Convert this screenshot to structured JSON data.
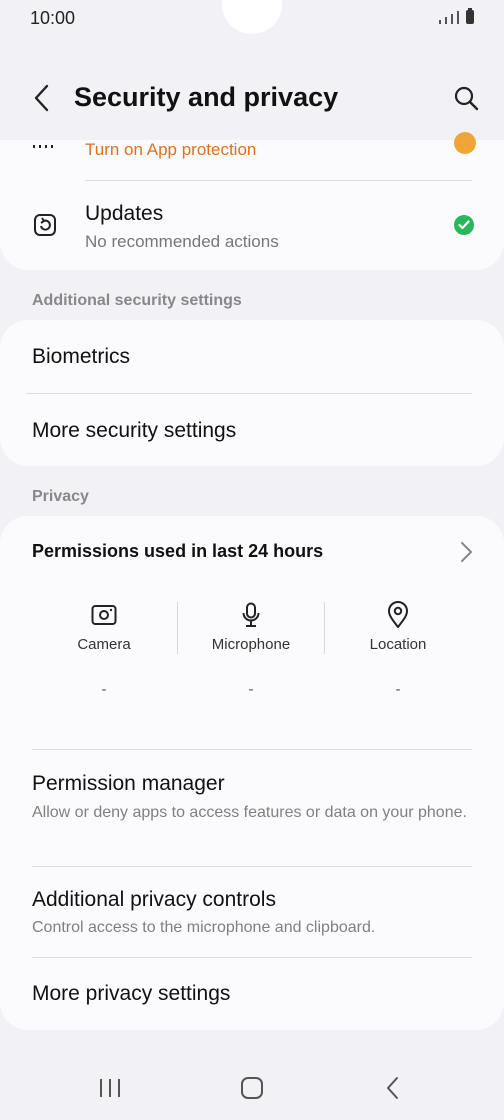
{
  "status_bar": {
    "time": "10:00"
  },
  "header": {
    "title": "Security and privacy"
  },
  "top_card": {
    "warning_text": "Turn on App protection",
    "updates_title": "Updates",
    "updates_subtitle": "No recommended actions"
  },
  "sections": {
    "additional_security": "Additional security settings",
    "privacy": "Privacy"
  },
  "security_items": [
    {
      "label": "Biometrics"
    },
    {
      "label": "More security settings"
    }
  ],
  "permissions": {
    "title": "Permissions used in last 24 hours",
    "items": [
      {
        "label": "Camera",
        "value": "-",
        "icon": "camera-icon"
      },
      {
        "label": "Microphone",
        "value": "-",
        "icon": "microphone-icon"
      },
      {
        "label": "Location",
        "value": "-",
        "icon": "location-icon"
      }
    ]
  },
  "privacy_items": [
    {
      "title": "Permission manager",
      "subtitle": "Allow or deny apps to access features or data on your phone."
    },
    {
      "title": "Additional privacy controls",
      "subtitle": "Control access to the microphone and clipboard."
    },
    {
      "title": "More privacy settings",
      "subtitle": ""
    }
  ],
  "colors": {
    "warning": "#e0701c",
    "success": "#26b85b",
    "warning_dot": "#f0a637"
  }
}
